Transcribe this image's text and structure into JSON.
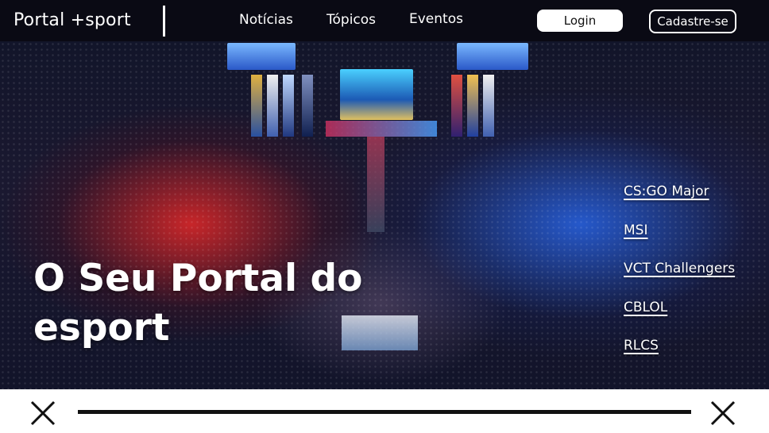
{
  "header": {
    "brand": "Portal +sport",
    "nav": [
      "Notícias",
      "Tópicos",
      "Eventos"
    ],
    "login_label": "Login",
    "signup_label": "Cadastre-se"
  },
  "hero": {
    "title_line1": "O Seu Portal do",
    "title_line2": "esport",
    "events": [
      "CS:GO Major",
      "MSI",
      "VCT Challengers",
      "CBLOL",
      "RLCS"
    ]
  },
  "carousel": {
    "left_icon": "close-icon",
    "right_icon": "close-icon"
  },
  "colors": {
    "header_bg": "#0a0a14",
    "accent_red": "#e62828",
    "accent_blue": "#2864e6"
  }
}
